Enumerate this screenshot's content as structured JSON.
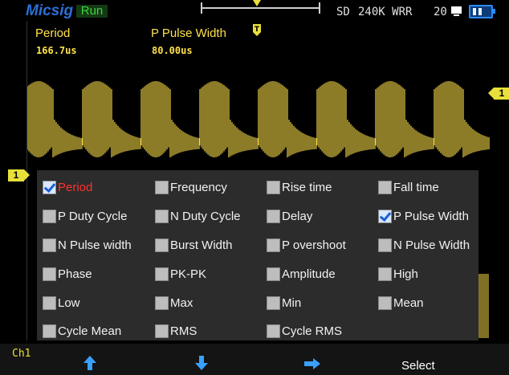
{
  "header": {
    "brand": "Micsig",
    "run_state": "Run",
    "storage_mode": "SD",
    "memory_depth": "240K WRR",
    "count": "20"
  },
  "measurements": [
    {
      "label": "Period",
      "value": "166.7us"
    },
    {
      "label": "P Pulse Width",
      "value": "80.00us"
    }
  ],
  "channel_marker": "1",
  "menu": {
    "items": [
      {
        "label": "Period",
        "checked": true,
        "active": true
      },
      {
        "label": "Frequency",
        "checked": false
      },
      {
        "label": "Rise time",
        "checked": false
      },
      {
        "label": "Fall time",
        "checked": false
      },
      {
        "label": "P Duty Cycle",
        "checked": false
      },
      {
        "label": "N Duty Cycle",
        "checked": false
      },
      {
        "label": "Delay",
        "checked": false
      },
      {
        "label": "P Pulse Width",
        "checked": true
      },
      {
        "label": "N Pulse width",
        "checked": false
      },
      {
        "label": "Burst Width",
        "checked": false
      },
      {
        "label": "P overshoot",
        "checked": false
      },
      {
        "label": "N Pulse Width",
        "checked": false
      },
      {
        "label": "Phase",
        "checked": false
      },
      {
        "label": "PK-PK",
        "checked": false
      },
      {
        "label": "Amplitude",
        "checked": false
      },
      {
        "label": "High",
        "checked": false
      },
      {
        "label": "Low",
        "checked": false
      },
      {
        "label": "Max",
        "checked": false
      },
      {
        "label": "Min",
        "checked": false
      },
      {
        "label": "Mean",
        "checked": false
      },
      {
        "label": "Cycle Mean",
        "checked": false
      },
      {
        "label": "RMS",
        "checked": false
      },
      {
        "label": "Cycle RMS",
        "checked": false
      }
    ]
  },
  "bottom": {
    "channel": "Ch1",
    "softkeys": [
      {
        "icon": "arrow-up-icon"
      },
      {
        "icon": "arrow-down-icon"
      },
      {
        "icon": "arrow-right-icon"
      }
    ],
    "select_label": "Select"
  },
  "colors": {
    "trace": "#ffe14a",
    "accent": "#2c8bff",
    "active_item": "#ff3030"
  }
}
